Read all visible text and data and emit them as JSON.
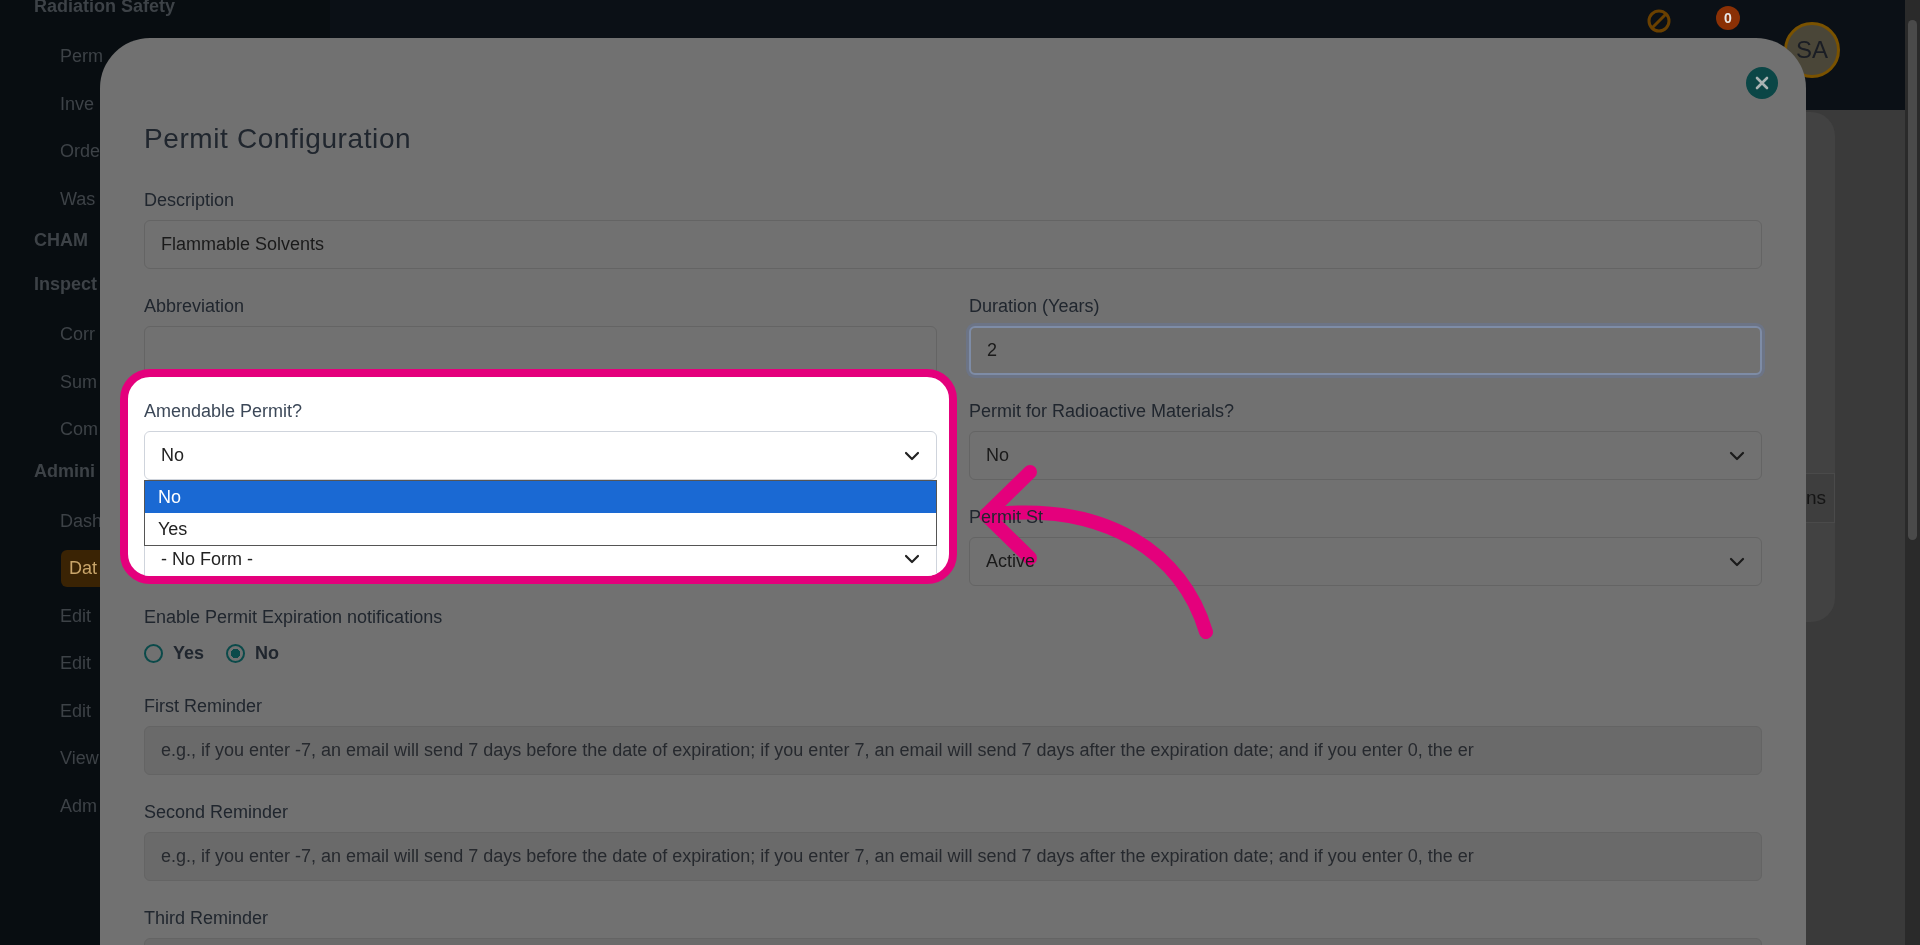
{
  "sidebar": {
    "sections": [
      {
        "title": "Radiation Safety",
        "items": [
          {
            "label": "Perm",
            "selected": false
          },
          {
            "label": "Inve",
            "selected": false
          },
          {
            "label": "Orde",
            "selected": false
          },
          {
            "label": "Was",
            "selected": false
          }
        ]
      },
      {
        "title": "CHAM"
      },
      {
        "title": "Inspect",
        "items": [
          {
            "label": "Corr",
            "selected": false
          },
          {
            "label": "Sum",
            "selected": false
          },
          {
            "label": "Com",
            "selected": false
          }
        ]
      },
      {
        "title": "Admini",
        "items": [
          {
            "label": "Dash",
            "selected": false
          },
          {
            "label": "Dat",
            "selected": true
          },
          {
            "label": "Edit",
            "selected": false
          },
          {
            "label": "Edit",
            "selected": false
          },
          {
            "label": "Edit",
            "selected": false
          },
          {
            "label": "View",
            "selected": false
          },
          {
            "label": "Adm",
            "selected": false
          }
        ]
      }
    ]
  },
  "topbar": {
    "notification_count": "0",
    "avatar_initials": "SA"
  },
  "background_button": "ns",
  "modal": {
    "title": "Permit Configuration",
    "description": {
      "label": "Description",
      "value": "Flammable Solvents"
    },
    "abbreviation": {
      "label": "Abbreviation"
    },
    "duration": {
      "label": "Duration (Years)",
      "value": "2",
      "focused": true
    },
    "amendable": {
      "label": "Amendable Permit?",
      "value": "No",
      "options": [
        {
          "label": "No",
          "selected": true
        },
        {
          "label": "Yes",
          "selected": false
        }
      ]
    },
    "form_select": {
      "value": "- No Form -"
    },
    "radioactive": {
      "label": "Permit for Radioactive Materials?",
      "value": "No"
    },
    "status": {
      "label": "Permit St",
      "value": "Active"
    },
    "notifications": {
      "label": "Enable Permit Expiration notifications",
      "options": [
        {
          "label": "Yes",
          "selected": false
        },
        {
          "label": "No",
          "selected": true
        }
      ]
    },
    "reminders": [
      {
        "label": "First Reminder",
        "placeholder": "e.g., if you enter -7, an email will send 7 days before the date of expiration; if you enter 7, an email will send 7 days after the expiration date; and if you enter 0, the er"
      },
      {
        "label": "Second Reminder",
        "placeholder": "e.g., if you enter -7, an email will send 7 days before the date of expiration; if you enter 7, an email will send 7 days after the expiration date; and if you enter 0, the er"
      },
      {
        "label": "Third Reminder"
      }
    ]
  }
}
